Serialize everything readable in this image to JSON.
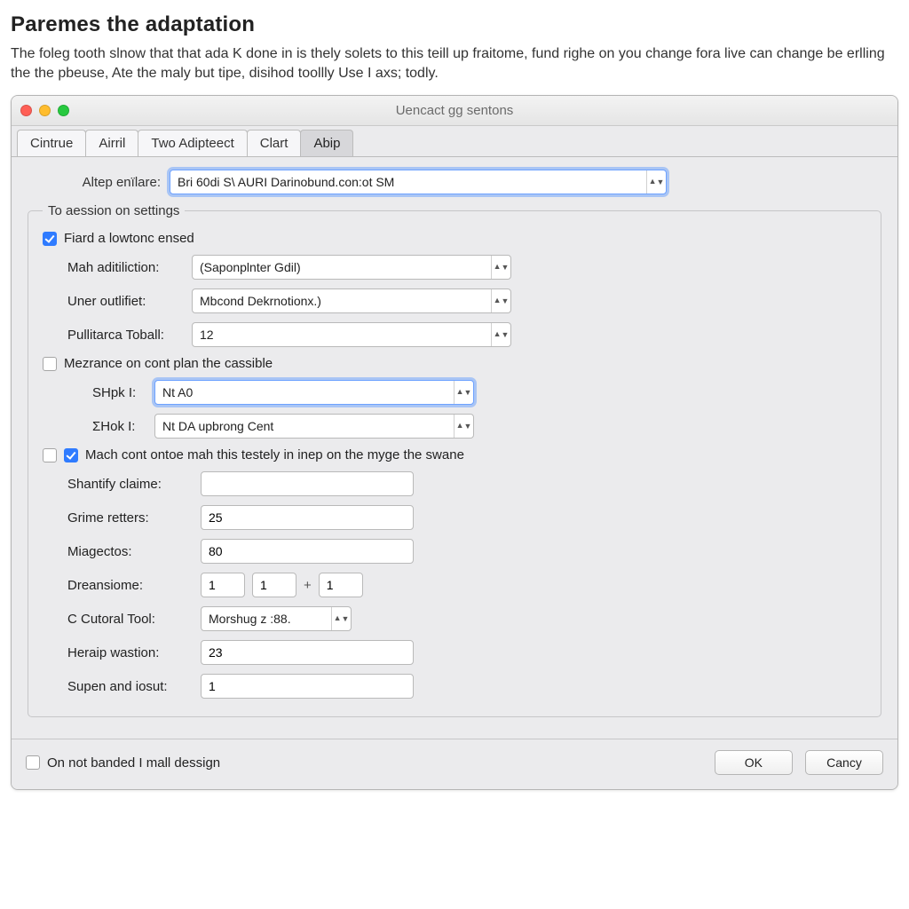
{
  "page": {
    "heading": "Paremes the adaptation",
    "intro": "The foleg tooth slnow that that ada K done in is thely solets to this teill up fraitome, fund righe on you change fora live can change be erlling the the pbeuse, Ate the maly but tipe, disihod toollly Use I axs; todly."
  },
  "window": {
    "title": "Uencact gg sentons",
    "tabs": [
      "Cintrue",
      "Airril",
      "Two Adipteect",
      "Clart",
      "Abip"
    ],
    "active_tab_index": 4
  },
  "form": {
    "top_combo": {
      "label": "Altep enïlare:",
      "value": "Bri 60di S\\ AURI Darinobund.con:ot SM"
    },
    "group_title": "To aession on settings",
    "cb_fiard": {
      "label": "Fiard a lowtonc ensed",
      "checked": true
    },
    "mah": {
      "label": "Mah aditiliction:",
      "value": "(Saponplnter Gdil)"
    },
    "uner": {
      "label": "Uner outlifiet:",
      "value": "Mbcond Dekrnotionx.)"
    },
    "pull": {
      "label": "Pullitarca Toball:",
      "value": "12"
    },
    "cb_mezr": {
      "label": "Mezrance on cont plan the cassible",
      "checked": false
    },
    "shpk": {
      "label": "SHpk I:",
      "value": "Nt A0"
    },
    "shok": {
      "label": "ƩHok I:",
      "value": "Nt DA upbrong Cent"
    },
    "cb_mach": {
      "label": "Mach cont ontoe mah this testely in inep on the myge the swane",
      "checked": true
    },
    "shantify": {
      "label": "Shantify claime:",
      "value": ""
    },
    "grime": {
      "label": "Grime retters:",
      "value": "25"
    },
    "miag": {
      "label": "Miagectos:",
      "value": "80"
    },
    "drean": {
      "label": "Dreansiome:",
      "a": "1",
      "b": "1",
      "c": "1",
      "sep": "+"
    },
    "ctool": {
      "label": "C Cutoral Tool:",
      "value": "Morshug z  :88."
    },
    "heraip": {
      "label": "Heraip wastion:",
      "value": "23"
    },
    "supen": {
      "label": "Supen and iosut:",
      "value": "1"
    },
    "footer_cb": {
      "label": "On not banded I mall dessign",
      "checked": false
    },
    "buttons": {
      "ok": "OK",
      "cancel": "Cancy"
    }
  }
}
